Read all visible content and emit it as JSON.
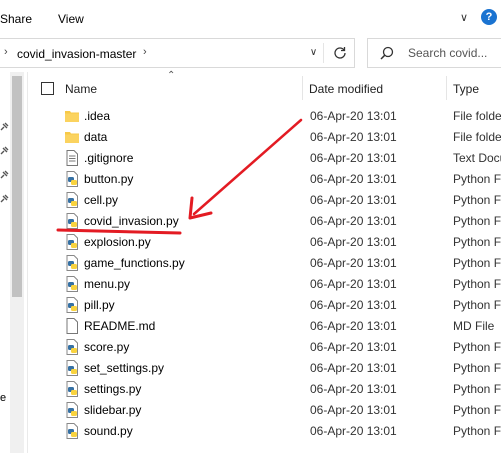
{
  "ribbon": {
    "tabs": [
      "Share",
      "View"
    ]
  },
  "address": {
    "crumb": "covid_invasion-master"
  },
  "search": {
    "placeholder": "Search covid..."
  },
  "columns": {
    "name": "Name",
    "date": "Date modified",
    "type": "Type"
  },
  "nav": {
    "partial_label": "e"
  },
  "files": [
    {
      "name": ".idea",
      "date": "06-Apr-20 13:01",
      "type": "File folde",
      "icon": "folder-icon"
    },
    {
      "name": "data",
      "date": "06-Apr-20 13:01",
      "type": "File folde",
      "icon": "folder-icon"
    },
    {
      "name": ".gitignore",
      "date": "06-Apr-20 13:01",
      "type": "Text Docu",
      "icon": "text-file-icon"
    },
    {
      "name": "button.py",
      "date": "06-Apr-20 13:01",
      "type": "Python F",
      "icon": "python-file-icon"
    },
    {
      "name": "cell.py",
      "date": "06-Apr-20 13:01",
      "type": "Python F",
      "icon": "python-file-icon"
    },
    {
      "name": "covid_invasion.py",
      "date": "06-Apr-20 13:01",
      "type": "Python F",
      "icon": "python-file-icon"
    },
    {
      "name": "explosion.py",
      "date": "06-Apr-20 13:01",
      "type": "Python F",
      "icon": "python-file-icon"
    },
    {
      "name": "game_functions.py",
      "date": "06-Apr-20 13:01",
      "type": "Python F",
      "icon": "python-file-icon"
    },
    {
      "name": "menu.py",
      "date": "06-Apr-20 13:01",
      "type": "Python F",
      "icon": "python-file-icon"
    },
    {
      "name": "pill.py",
      "date": "06-Apr-20 13:01",
      "type": "Python F",
      "icon": "python-file-icon"
    },
    {
      "name": "README.md",
      "date": "06-Apr-20 13:01",
      "type": "MD File",
      "icon": "text-file-icon"
    },
    {
      "name": "score.py",
      "date": "06-Apr-20 13:01",
      "type": "Python F",
      "icon": "python-file-icon"
    },
    {
      "name": "set_settings.py",
      "date": "06-Apr-20 13:01",
      "type": "Python F",
      "icon": "python-file-icon"
    },
    {
      "name": "settings.py",
      "date": "06-Apr-20 13:01",
      "type": "Python F",
      "icon": "python-file-icon"
    },
    {
      "name": "slidebar.py",
      "date": "06-Apr-20 13:01",
      "type": "Python F",
      "icon": "python-file-icon"
    },
    {
      "name": "sound.py",
      "date": "06-Apr-20 13:01",
      "type": "Python F",
      "icon": "python-file-icon"
    }
  ],
  "annotation": {
    "color": "#e31b23",
    "target_file": "covid_invasion.py"
  },
  "colors": {
    "folder": "#f7c948",
    "python_blue": "#3671a4",
    "python_yellow": "#f9d33f",
    "help": "#1a73d1"
  }
}
